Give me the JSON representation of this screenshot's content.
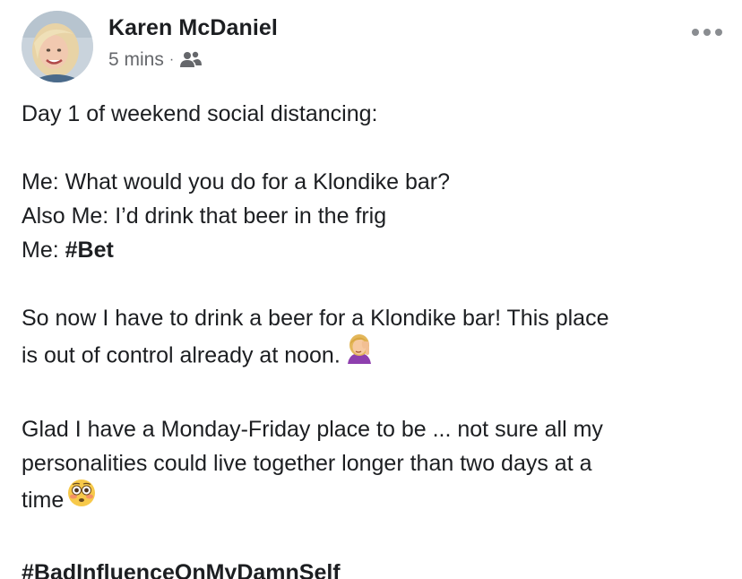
{
  "post": {
    "author": "Karen McDaniel",
    "time": "5 mins",
    "separator": "·",
    "audience_icon": "friends-icon",
    "more_icon": "more-options-icon",
    "lines": {
      "l1": "Day 1 of weekend social distancing:",
      "l2": "Me: What would you do for a Klondike bar?",
      "l3": "Also Me: I’d drink that beer in the frig",
      "l4_prefix": "Me: ",
      "l4_hashtag": "#Bet",
      "l5": "So now I have to drink a beer for a Klondike bar! This place",
      "l6": "is out of control already at noon.",
      "l7": "Glad I have a Monday-Friday place to be ... not sure all my",
      "l8": "personalities could live together longer than two days at a",
      "l9": "time",
      "hashtag_final": "#BadInfluenceOnMyDamnSelf"
    },
    "emojis": {
      "facepalm": "woman-facepalming-emoji",
      "flushed": "flushed-face-emoji"
    },
    "colors": {
      "text": "#1c1e21",
      "meta": "#65676b",
      "icon": "#8a8d91"
    }
  }
}
